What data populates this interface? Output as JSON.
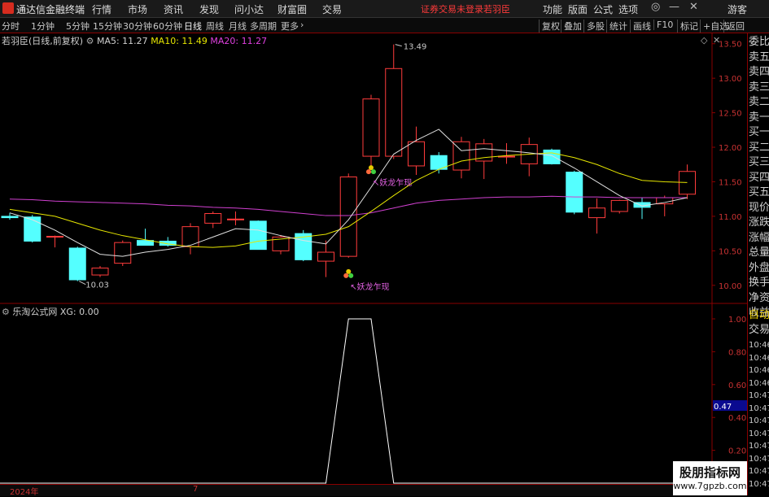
{
  "app": {
    "title": "通达信金融终端",
    "status": "证券交易未登录",
    "stock_short": "若羽臣",
    "menu": [
      "行情",
      "市场",
      "资讯",
      "发现",
      "问小达",
      "财富圈",
      "交易"
    ],
    "window_menu": [
      "功能",
      "版面",
      "公式",
      "选项"
    ],
    "guest": "游客"
  },
  "periods": [
    "分时",
    "1分钟",
    "5分钟",
    "15分钟",
    "30分钟",
    "60分钟",
    "日线",
    "周线",
    "月线",
    "多周期",
    "更多"
  ],
  "active_period": "日线",
  "right_buttons": [
    "复权",
    "叠加",
    "多股",
    "统计",
    "画线",
    "F10",
    "标记",
    "+自选",
    "返回"
  ],
  "legend": {
    "title": "若羽臣(日线,前复权)",
    "ma5": "MA5: 11.27",
    "ma10": "MA10: 11.49",
    "ma20": "MA20: 11.27"
  },
  "indicator_legend": {
    "title": "乐淘公式网",
    "xg": "XG: 0.00"
  },
  "annotations": {
    "high": "13.49",
    "low": "10.03",
    "signal": "妖龙乍现"
  },
  "y_axis_main": [
    "13.50",
    "13.00",
    "12.50",
    "12.00",
    "11.50",
    "11.00",
    "10.50",
    "10.00"
  ],
  "y_axis_ind": [
    "1.00",
    "0.80",
    "0.60",
    "0.47",
    "0.40",
    "0.20"
  ],
  "right_panel": [
    "委比",
    "卖五",
    "卖四",
    "卖三",
    "卖二",
    "卖一",
    "买一",
    "买二",
    "买三",
    "买四",
    "买五",
    "现价",
    "涨跌",
    "涨幅",
    "总量",
    "外盘",
    "换手",
    "净资",
    "收益"
  ],
  "right_panel_2": [
    "自动",
    "交易"
  ],
  "right_panel_times": [
    "10:46",
    "10:46",
    "10:46",
    "10:46",
    "10:47",
    "10:47",
    "10:47",
    "10:47",
    "10:47",
    "10:47",
    "10:47",
    "10:47"
  ],
  "bottom": {
    "year": "2024年",
    "month": "7"
  },
  "watermark": {
    "line1": "股朋指标网",
    "line2": "www.7gpzb.com"
  },
  "chart_data": {
    "type": "candlestick",
    "ylim": [
      9.75,
      13.65
    ],
    "candles": [
      {
        "o": 11.0,
        "h": 11.05,
        "l": 10.95,
        "c": 10.98
      },
      {
        "o": 10.99,
        "h": 11.02,
        "l": 10.62,
        "c": 10.64
      },
      {
        "o": 10.7,
        "h": 10.72,
        "l": 10.55,
        "c": 10.71
      },
      {
        "o": 10.54,
        "h": 10.56,
        "l": 10.06,
        "c": 10.08
      },
      {
        "o": 10.15,
        "h": 10.28,
        "l": 10.12,
        "c": 10.25
      },
      {
        "o": 10.32,
        "h": 10.65,
        "l": 10.28,
        "c": 10.62
      },
      {
        "o": 10.65,
        "h": 10.82,
        "l": 10.58,
        "c": 10.58
      },
      {
        "o": 10.64,
        "h": 10.7,
        "l": 10.56,
        "c": 10.58
      },
      {
        "o": 10.56,
        "h": 10.9,
        "l": 10.45,
        "c": 10.85
      },
      {
        "o": 10.9,
        "h": 11.07,
        "l": 10.83,
        "c": 11.04
      },
      {
        "o": 10.96,
        "h": 11.07,
        "l": 10.87,
        "c": 10.96
      },
      {
        "o": 10.93,
        "h": 10.94,
        "l": 10.52,
        "c": 10.52
      },
      {
        "o": 10.5,
        "h": 10.73,
        "l": 10.45,
        "c": 10.7
      },
      {
        "o": 10.75,
        "h": 10.8,
        "l": 10.35,
        "c": 10.37
      },
      {
        "o": 10.35,
        "h": 10.65,
        "l": 10.12,
        "c": 10.48
      },
      {
        "o": 10.42,
        "h": 11.62,
        "l": 10.4,
        "c": 11.57
      },
      {
        "o": 11.87,
        "h": 12.76,
        "l": 11.73,
        "c": 12.7
      },
      {
        "o": 11.87,
        "h": 13.49,
        "l": 11.83,
        "c": 13.14
      },
      {
        "o": 11.73,
        "h": 12.3,
        "l": 11.6,
        "c": 12.08
      },
      {
        "o": 11.88,
        "h": 11.93,
        "l": 11.62,
        "c": 11.68
      },
      {
        "o": 11.67,
        "h": 12.15,
        "l": 11.55,
        "c": 12.08
      },
      {
        "o": 11.8,
        "h": 12.12,
        "l": 11.54,
        "c": 12.05
      },
      {
        "o": 11.86,
        "h": 12.06,
        "l": 11.76,
        "c": 11.87
      },
      {
        "o": 11.76,
        "h": 12.14,
        "l": 11.58,
        "c": 12.04
      },
      {
        "o": 11.96,
        "h": 11.98,
        "l": 11.75,
        "c": 11.76
      },
      {
        "o": 11.64,
        "h": 11.66,
        "l": 11.03,
        "c": 11.06
      },
      {
        "o": 10.98,
        "h": 11.26,
        "l": 10.75,
        "c": 11.12
      },
      {
        "o": 11.07,
        "h": 11.24,
        "l": 11.04,
        "c": 11.23
      },
      {
        "o": 11.2,
        "h": 11.27,
        "l": 10.96,
        "c": 11.13
      },
      {
        "o": 11.18,
        "h": 11.3,
        "l": 11.0,
        "c": 11.27
      },
      {
        "o": 11.32,
        "h": 11.75,
        "l": 11.25,
        "c": 11.65
      }
    ],
    "ma5": [
      11.05,
      10.95,
      10.8,
      10.62,
      10.45,
      10.42,
      10.48,
      10.52,
      10.58,
      10.7,
      10.82,
      10.8,
      10.72,
      10.65,
      10.6,
      10.95,
      11.42,
      11.9,
      12.1,
      12.26,
      11.95,
      11.98,
      11.95,
      11.92,
      11.88,
      11.7,
      11.5,
      11.3,
      11.15,
      11.2,
      11.27
    ],
    "ma10": [
      11.1,
      11.05,
      11.0,
      10.9,
      10.8,
      10.72,
      10.66,
      10.6,
      10.56,
      10.55,
      10.57,
      10.64,
      10.67,
      10.7,
      10.74,
      10.85,
      11.07,
      11.3,
      11.52,
      11.68,
      11.8,
      11.85,
      11.88,
      11.9,
      11.92,
      11.85,
      11.75,
      11.62,
      11.52,
      11.5,
      11.49
    ],
    "ma20": [
      11.25,
      11.24,
      11.22,
      11.21,
      11.2,
      11.19,
      11.18,
      11.16,
      11.15,
      11.13,
      11.12,
      11.1,
      11.07,
      11.04,
      11.01,
      11.01,
      11.05,
      11.12,
      11.19,
      11.23,
      11.25,
      11.27,
      11.28,
      11.28,
      11.29,
      11.28,
      11.28,
      11.27,
      11.27,
      11.27,
      11.27
    ],
    "signals": [
      15,
      16
    ],
    "xg": [
      0,
      0,
      0,
      0,
      0,
      0,
      0,
      0,
      0,
      0,
      0,
      0,
      0,
      0,
      0,
      1,
      1,
      0,
      0,
      0,
      0,
      0,
      0,
      0,
      0,
      0,
      0,
      0,
      0,
      0,
      0
    ]
  }
}
